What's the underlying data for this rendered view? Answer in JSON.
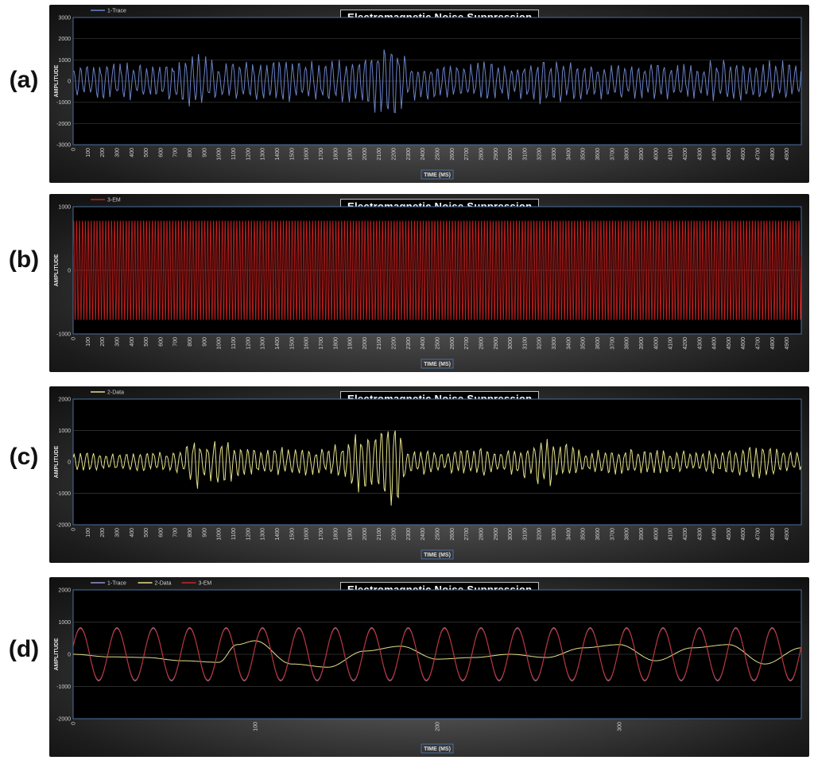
{
  "panels": [
    {
      "id": "a",
      "label": "(a)"
    },
    {
      "id": "b",
      "label": "(b)"
    },
    {
      "id": "c",
      "label": "(c)"
    },
    {
      "id": "d",
      "label": "(d)"
    }
  ],
  "chart_data": [
    {
      "type": "line",
      "title": "Electromagnetic Noise Suppression",
      "xlabel": "TIME (MS)",
      "ylabel": "AMPLITUDE",
      "xlim": [
        0,
        5000
      ],
      "ylim": [
        -3000,
        3000
      ],
      "yticks": [
        -3000,
        -2000,
        -1000,
        0,
        1000,
        2000,
        3000
      ],
      "xticks": [
        0,
        100,
        200,
        300,
        400,
        500,
        600,
        700,
        800,
        900,
        1000,
        1100,
        1200,
        1300,
        1400,
        1500,
        1600,
        1700,
        1800,
        1900,
        2000,
        2100,
        2200,
        2300,
        2400,
        2500,
        2600,
        2700,
        2800,
        2900,
        3000,
        3100,
        3200,
        3300,
        3400,
        3500,
        3600,
        3700,
        3800,
        3900,
        4000,
        4100,
        4200,
        4300,
        4400,
        4500,
        4600,
        4700,
        4800,
        4900
      ],
      "legend": "top-left",
      "series": [
        {
          "name": "1-Trace",
          "color": "#6b82c8",
          "description_points": {
            "x": [
              0,
              250,
              500,
              750,
              850,
              1000,
              1250,
              1500,
              1750,
              2000,
              2100,
              2200,
              2250,
              2300,
              2500,
              2750,
              3000,
              3250,
              3500,
              3750,
              4000,
              4250,
              4500,
              4750,
              5000
            ],
            "envelope": [
              800,
              950,
              900,
              1100,
              1500,
              900,
              1000,
              1100,
              950,
              1300,
              1900,
              2000,
              1700,
              1000,
              900,
              1000,
              900,
              1200,
              950,
              900,
              950,
              900,
              1100,
              1000,
              950
            ]
          }
        }
      ]
    },
    {
      "type": "line",
      "title": "Electromagnetic Noise Suppression",
      "xlabel": "TIME (MS)",
      "ylabel": "AMPLITUDE",
      "xlim": [
        0,
        5000
      ],
      "ylim": [
        -1000,
        1000
      ],
      "yticks": [
        -1000,
        0,
        1000
      ],
      "xticks": [
        0,
        100,
        200,
        300,
        400,
        500,
        600,
        700,
        800,
        900,
        1000,
        1100,
        1200,
        1300,
        1400,
        1500,
        1600,
        1700,
        1800,
        1900,
        2000,
        2100,
        2200,
        2300,
        2400,
        2500,
        2600,
        2700,
        2800,
        2900,
        3000,
        3100,
        3200,
        3300,
        3400,
        3500,
        3600,
        3700,
        3800,
        3900,
        4000,
        4100,
        4200,
        4300,
        4400,
        4500,
        4600,
        4700,
        4800,
        4900
      ],
      "legend": "top-left",
      "series": [
        {
          "name": "3-EM",
          "color": "#c0201e",
          "amplitude": 800,
          "frequency_hz": 50
        }
      ]
    },
    {
      "type": "line",
      "title": "Electromagnetic Noise Suppression",
      "xlabel": "TIME (MS)",
      "ylabel": "AMPLITUDE",
      "xlim": [
        0,
        5000
      ],
      "ylim": [
        -2000,
        2000
      ],
      "yticks": [
        -2000,
        -1000,
        0,
        1000,
        2000
      ],
      "xticks": [
        0,
        100,
        200,
        300,
        400,
        500,
        600,
        700,
        800,
        900,
        1000,
        1100,
        1200,
        1300,
        1400,
        1500,
        1600,
        1700,
        1800,
        1900,
        2000,
        2100,
        2200,
        2300,
        2400,
        2500,
        2600,
        2700,
        2800,
        2900,
        3000,
        3100,
        3200,
        3300,
        3400,
        3500,
        3600,
        3700,
        3800,
        3900,
        4000,
        4100,
        4200,
        4300,
        4400,
        4500,
        4600,
        4700,
        4800,
        4900
      ],
      "legend": "top-left",
      "series": [
        {
          "name": "2-Data",
          "color": "#e4e08a",
          "description_points": {
            "x": [
              0,
              250,
              500,
              750,
              800,
              850,
              900,
              1000,
              1250,
              1500,
              1750,
              2000,
              2100,
              2200,
              2250,
              2300,
              2500,
              2750,
              3000,
              3250,
              3500,
              3750,
              4000,
              4250,
              4500,
              4750,
              5000
            ],
            "envelope": [
              350,
              300,
              350,
              450,
              700,
              900,
              700,
              800,
              450,
              500,
              450,
              1100,
              1300,
              1500,
              1300,
              500,
              400,
              500,
              400,
              900,
              400,
              450,
              400,
              350,
              500,
              550,
              300
            ]
          }
        }
      ]
    },
    {
      "type": "line",
      "title": "Electromagnetic Noise Suppression",
      "xlabel": "TIME (MS)",
      "ylabel": "AMPLITUDE",
      "xlim": [
        0,
        400
      ],
      "ylim": [
        -2000,
        2000
      ],
      "yticks": [
        -2000,
        -1000,
        0,
        1000,
        2000
      ],
      "xticks": [
        0,
        100,
        200,
        300
      ],
      "legend": "top-left",
      "series": [
        {
          "name": "1-Trace",
          "color": "#8e94cf",
          "amplitude": 820,
          "frequency_hz": 50
        },
        {
          "name": "2-Data",
          "color": "#e4e08a",
          "points": {
            "x": [
              0,
              20,
              40,
              60,
              80,
              90,
              100,
              120,
              140,
              160,
              180,
              200,
              220,
              240,
              260,
              280,
              300,
              320,
              340,
              360,
              380,
              400
            ],
            "y": [
              0,
              -80,
              -100,
              -200,
              -250,
              300,
              420,
              -300,
              -400,
              100,
              250,
              -150,
              -100,
              0,
              -100,
              200,
              300,
              -200,
              200,
              300,
              -300,
              200
            ]
          }
        },
        {
          "name": "3-EM",
          "color": "#c8282a",
          "amplitude": 800,
          "frequency_hz": 50
        }
      ]
    }
  ]
}
